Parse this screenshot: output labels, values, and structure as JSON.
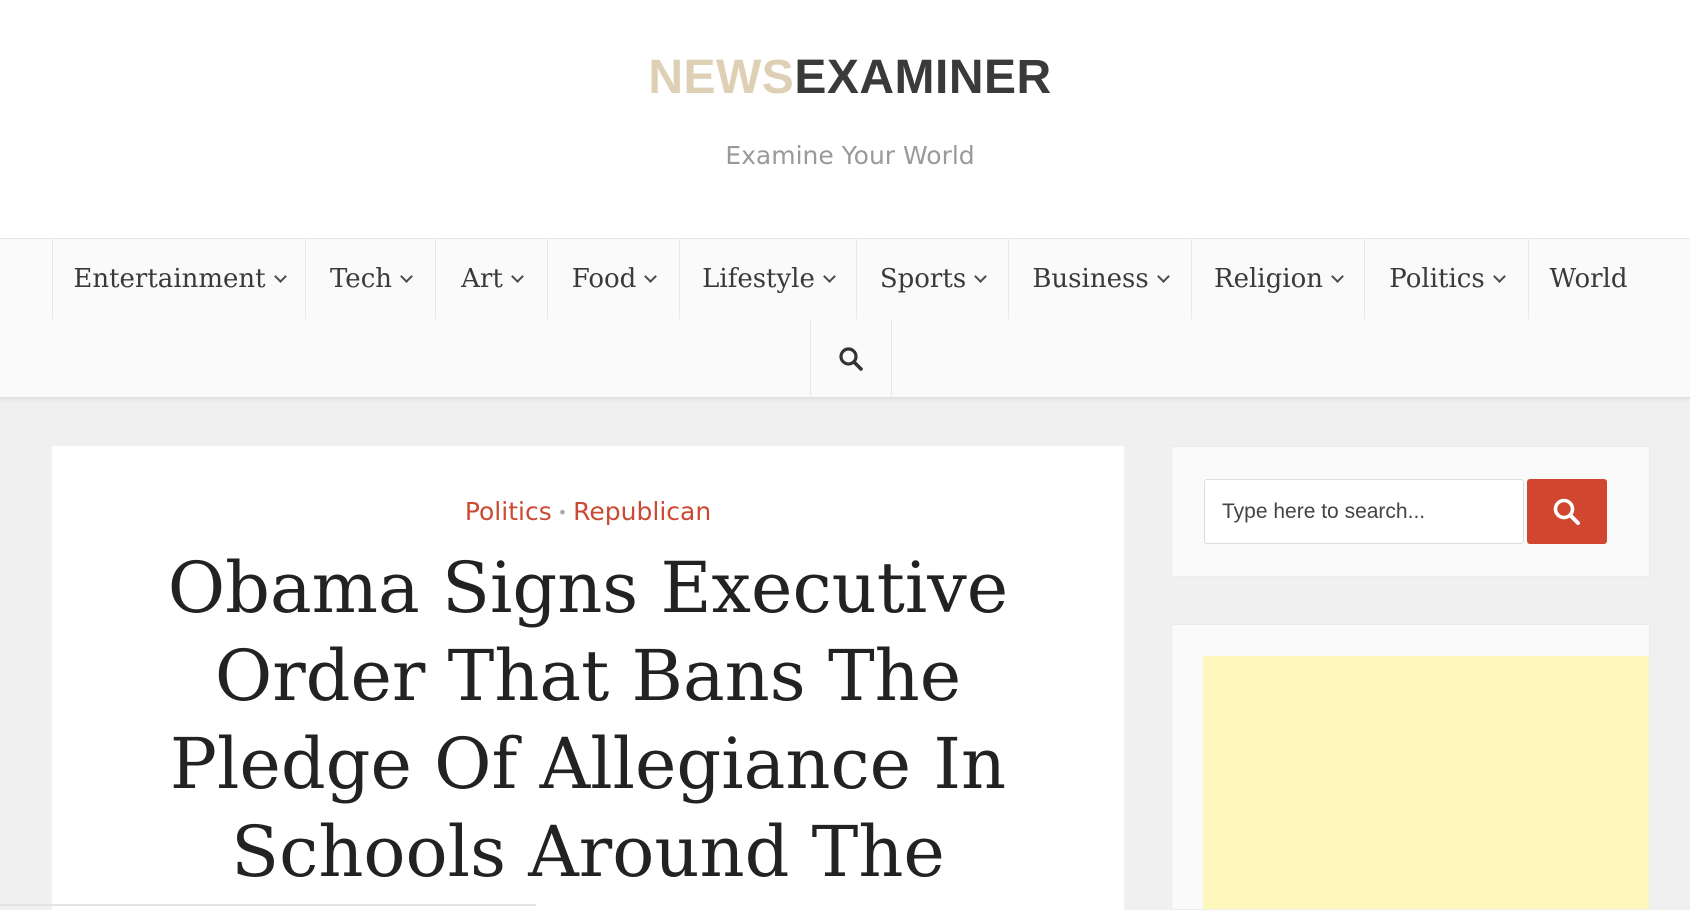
{
  "site": {
    "logo_part1": "NEWS",
    "logo_part2": "EXAMINER",
    "tagline": "Examine Your World"
  },
  "nav": {
    "items": [
      {
        "label": "Entertainment",
        "dropdown": true
      },
      {
        "label": "Tech",
        "dropdown": true
      },
      {
        "label": "Art",
        "dropdown": true
      },
      {
        "label": "Food",
        "dropdown": true
      },
      {
        "label": "Lifestyle",
        "dropdown": true
      },
      {
        "label": "Sports",
        "dropdown": true
      },
      {
        "label": "Business",
        "dropdown": true
      },
      {
        "label": "Religion",
        "dropdown": true
      },
      {
        "label": "Politics",
        "dropdown": true
      },
      {
        "label": "World",
        "dropdown": false
      }
    ],
    "search_icon": "search-icon"
  },
  "article": {
    "categories": [
      "Politics",
      "Republican"
    ],
    "category_separator": "•",
    "title": "Obama Signs Executive Order That Bans The Pledge Of Allegiance In Schools Around The"
  },
  "sidebar": {
    "search": {
      "placeholder": "Type here to search...",
      "button_icon": "search-icon"
    },
    "ad": {
      "background": "#fff8bd"
    }
  },
  "colors": {
    "accent": "#cc4a33",
    "logo_light": "#ddd0b4",
    "logo_dark": "#3a3a3a",
    "search_button": "#d0462f"
  }
}
